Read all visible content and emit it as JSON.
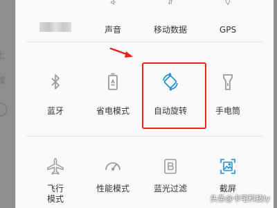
{
  "row1": {
    "tiles": [
      {
        "label": ""
      },
      {
        "label": "声音"
      },
      {
        "label": "移动数据"
      },
      {
        "label": "GPS"
      }
    ]
  },
  "row2": {
    "tiles": [
      {
        "label": "蓝牙"
      },
      {
        "label": "省电模式"
      },
      {
        "label": "自动旋转"
      },
      {
        "label": "手电筒"
      }
    ]
  },
  "row3": {
    "tiles": [
      {
        "label": "飞行",
        "label2": "模式"
      },
      {
        "label": "性能模式"
      },
      {
        "label": "蓝光过滤"
      },
      {
        "label": "截屏"
      }
    ]
  },
  "background_ghost": {
    "text1": "上",
    "text2": "咖"
  },
  "watermark": "头条@卡宅科技ly",
  "colors": {
    "active": "#1e90d6",
    "inactive": "#9a9a9a",
    "highlight": "#e8221f"
  },
  "icons": {
    "row1": [
      "blurred",
      "volume-icon",
      "mobile-data-icon",
      "gps-icon"
    ],
    "row2": [
      "bluetooth-icon",
      "battery-saver-icon",
      "auto-rotate-icon",
      "flashlight-icon"
    ],
    "row3": [
      "airplane-icon",
      "performance-icon",
      "blue-light-filter-icon",
      "screenshot-icon"
    ]
  }
}
